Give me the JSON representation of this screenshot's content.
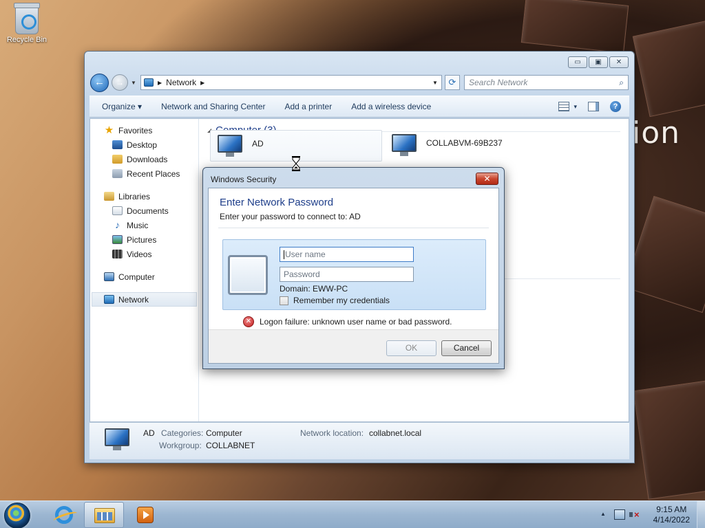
{
  "desktop": {
    "recycle_bin_label": "Recycle Bin",
    "wallpaper_text": "ion"
  },
  "explorer": {
    "caption_buttons": {
      "minimize": "▭",
      "maximize": "▣",
      "close": "✕"
    },
    "address": {
      "breadcrumb": [
        "Network"
      ],
      "search_placeholder": "Search Network"
    },
    "toolbar": {
      "organize": "Organize ▾",
      "network_center": "Network and Sharing Center",
      "add_printer": "Add a printer",
      "add_wireless": "Add a wireless device",
      "view_dropdown": "▾",
      "help": "?"
    },
    "nav": {
      "favorites": {
        "label": "Favorites",
        "items": [
          "Desktop",
          "Downloads",
          "Recent Places"
        ]
      },
      "libraries": {
        "label": "Libraries",
        "items": [
          "Documents",
          "Music",
          "Pictures",
          "Videos"
        ]
      },
      "computer": "Computer",
      "network": "Network"
    },
    "content": {
      "group_header": "Computer (3)",
      "computers": [
        {
          "name": "AD"
        },
        {
          "name": "COLLABVM-69B237"
        }
      ]
    },
    "details": {
      "name": "AD",
      "categories_label": "Categories:",
      "categories_value": "Computer",
      "workgroup_label": "Workgroup:",
      "workgroup_value": "COLLABNET",
      "location_label": "Network location:",
      "location_value": "collabnet.local"
    }
  },
  "dialog": {
    "title": "Windows Security",
    "close": "✕",
    "heading": "Enter Network Password",
    "subheading": "Enter your password to connect to: AD",
    "username_placeholder": "User name",
    "password_placeholder": "Password",
    "domain": "Domain: EWW-PC",
    "remember_label": "Remember my credentials",
    "remember_checked": false,
    "error": "Logon failure: unknown user name or bad password.",
    "error_icon": "✕",
    "ok": "OK",
    "cancel": "Cancel"
  },
  "taskbar": {
    "time": "9:15 AM",
    "date": "4/14/2022",
    "tray_up": "▲"
  },
  "colors": {
    "dialog_heading": "#1e3e8a",
    "close_button": "#c9462f",
    "error_icon": "#c31d1d"
  }
}
